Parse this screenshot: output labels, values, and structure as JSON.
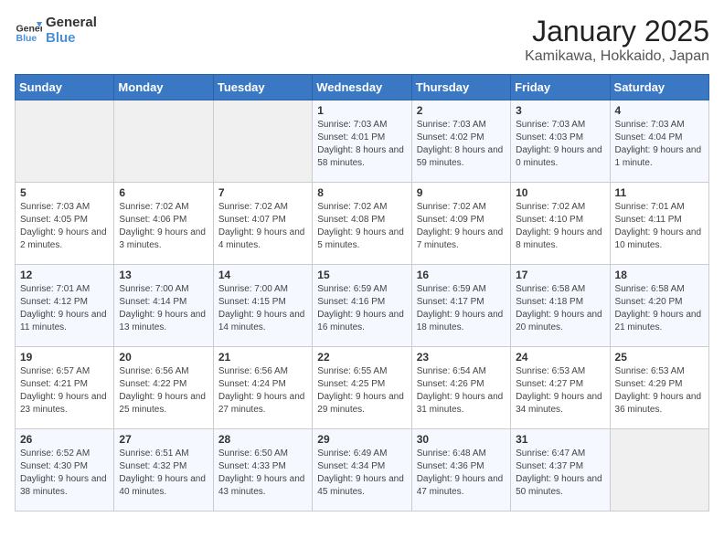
{
  "header": {
    "logo_line1": "General",
    "logo_line2": "Blue",
    "title": "January 2025",
    "subtitle": "Kamikawa, Hokkaido, Japan"
  },
  "weekdays": [
    "Sunday",
    "Monday",
    "Tuesday",
    "Wednesday",
    "Thursday",
    "Friday",
    "Saturday"
  ],
  "weeks": [
    [
      {
        "day": "",
        "sunrise": "",
        "sunset": "",
        "daylight": ""
      },
      {
        "day": "",
        "sunrise": "",
        "sunset": "",
        "daylight": ""
      },
      {
        "day": "",
        "sunrise": "",
        "sunset": "",
        "daylight": ""
      },
      {
        "day": "1",
        "sunrise": "Sunrise: 7:03 AM",
        "sunset": "Sunset: 4:01 PM",
        "daylight": "Daylight: 8 hours and 58 minutes."
      },
      {
        "day": "2",
        "sunrise": "Sunrise: 7:03 AM",
        "sunset": "Sunset: 4:02 PM",
        "daylight": "Daylight: 8 hours and 59 minutes."
      },
      {
        "day": "3",
        "sunrise": "Sunrise: 7:03 AM",
        "sunset": "Sunset: 4:03 PM",
        "daylight": "Daylight: 9 hours and 0 minutes."
      },
      {
        "day": "4",
        "sunrise": "Sunrise: 7:03 AM",
        "sunset": "Sunset: 4:04 PM",
        "daylight": "Daylight: 9 hours and 1 minute."
      }
    ],
    [
      {
        "day": "5",
        "sunrise": "Sunrise: 7:03 AM",
        "sunset": "Sunset: 4:05 PM",
        "daylight": "Daylight: 9 hours and 2 minutes."
      },
      {
        "day": "6",
        "sunrise": "Sunrise: 7:02 AM",
        "sunset": "Sunset: 4:06 PM",
        "daylight": "Daylight: 9 hours and 3 minutes."
      },
      {
        "day": "7",
        "sunrise": "Sunrise: 7:02 AM",
        "sunset": "Sunset: 4:07 PM",
        "daylight": "Daylight: 9 hours and 4 minutes."
      },
      {
        "day": "8",
        "sunrise": "Sunrise: 7:02 AM",
        "sunset": "Sunset: 4:08 PM",
        "daylight": "Daylight: 9 hours and 5 minutes."
      },
      {
        "day": "9",
        "sunrise": "Sunrise: 7:02 AM",
        "sunset": "Sunset: 4:09 PM",
        "daylight": "Daylight: 9 hours and 7 minutes."
      },
      {
        "day": "10",
        "sunrise": "Sunrise: 7:02 AM",
        "sunset": "Sunset: 4:10 PM",
        "daylight": "Daylight: 9 hours and 8 minutes."
      },
      {
        "day": "11",
        "sunrise": "Sunrise: 7:01 AM",
        "sunset": "Sunset: 4:11 PM",
        "daylight": "Daylight: 9 hours and 10 minutes."
      }
    ],
    [
      {
        "day": "12",
        "sunrise": "Sunrise: 7:01 AM",
        "sunset": "Sunset: 4:12 PM",
        "daylight": "Daylight: 9 hours and 11 minutes."
      },
      {
        "day": "13",
        "sunrise": "Sunrise: 7:00 AM",
        "sunset": "Sunset: 4:14 PM",
        "daylight": "Daylight: 9 hours and 13 minutes."
      },
      {
        "day": "14",
        "sunrise": "Sunrise: 7:00 AM",
        "sunset": "Sunset: 4:15 PM",
        "daylight": "Daylight: 9 hours and 14 minutes."
      },
      {
        "day": "15",
        "sunrise": "Sunrise: 6:59 AM",
        "sunset": "Sunset: 4:16 PM",
        "daylight": "Daylight: 9 hours and 16 minutes."
      },
      {
        "day": "16",
        "sunrise": "Sunrise: 6:59 AM",
        "sunset": "Sunset: 4:17 PM",
        "daylight": "Daylight: 9 hours and 18 minutes."
      },
      {
        "day": "17",
        "sunrise": "Sunrise: 6:58 AM",
        "sunset": "Sunset: 4:18 PM",
        "daylight": "Daylight: 9 hours and 20 minutes."
      },
      {
        "day": "18",
        "sunrise": "Sunrise: 6:58 AM",
        "sunset": "Sunset: 4:20 PM",
        "daylight": "Daylight: 9 hours and 21 minutes."
      }
    ],
    [
      {
        "day": "19",
        "sunrise": "Sunrise: 6:57 AM",
        "sunset": "Sunset: 4:21 PM",
        "daylight": "Daylight: 9 hours and 23 minutes."
      },
      {
        "day": "20",
        "sunrise": "Sunrise: 6:56 AM",
        "sunset": "Sunset: 4:22 PM",
        "daylight": "Daylight: 9 hours and 25 minutes."
      },
      {
        "day": "21",
        "sunrise": "Sunrise: 6:56 AM",
        "sunset": "Sunset: 4:24 PM",
        "daylight": "Daylight: 9 hours and 27 minutes."
      },
      {
        "day": "22",
        "sunrise": "Sunrise: 6:55 AM",
        "sunset": "Sunset: 4:25 PM",
        "daylight": "Daylight: 9 hours and 29 minutes."
      },
      {
        "day": "23",
        "sunrise": "Sunrise: 6:54 AM",
        "sunset": "Sunset: 4:26 PM",
        "daylight": "Daylight: 9 hours and 31 minutes."
      },
      {
        "day": "24",
        "sunrise": "Sunrise: 6:53 AM",
        "sunset": "Sunset: 4:27 PM",
        "daylight": "Daylight: 9 hours and 34 minutes."
      },
      {
        "day": "25",
        "sunrise": "Sunrise: 6:53 AM",
        "sunset": "Sunset: 4:29 PM",
        "daylight": "Daylight: 9 hours and 36 minutes."
      }
    ],
    [
      {
        "day": "26",
        "sunrise": "Sunrise: 6:52 AM",
        "sunset": "Sunset: 4:30 PM",
        "daylight": "Daylight: 9 hours and 38 minutes."
      },
      {
        "day": "27",
        "sunrise": "Sunrise: 6:51 AM",
        "sunset": "Sunset: 4:32 PM",
        "daylight": "Daylight: 9 hours and 40 minutes."
      },
      {
        "day": "28",
        "sunrise": "Sunrise: 6:50 AM",
        "sunset": "Sunset: 4:33 PM",
        "daylight": "Daylight: 9 hours and 43 minutes."
      },
      {
        "day": "29",
        "sunrise": "Sunrise: 6:49 AM",
        "sunset": "Sunset: 4:34 PM",
        "daylight": "Daylight: 9 hours and 45 minutes."
      },
      {
        "day": "30",
        "sunrise": "Sunrise: 6:48 AM",
        "sunset": "Sunset: 4:36 PM",
        "daylight": "Daylight: 9 hours and 47 minutes."
      },
      {
        "day": "31",
        "sunrise": "Sunrise: 6:47 AM",
        "sunset": "Sunset: 4:37 PM",
        "daylight": "Daylight: 9 hours and 50 minutes."
      },
      {
        "day": "",
        "sunrise": "",
        "sunset": "",
        "daylight": ""
      }
    ]
  ]
}
